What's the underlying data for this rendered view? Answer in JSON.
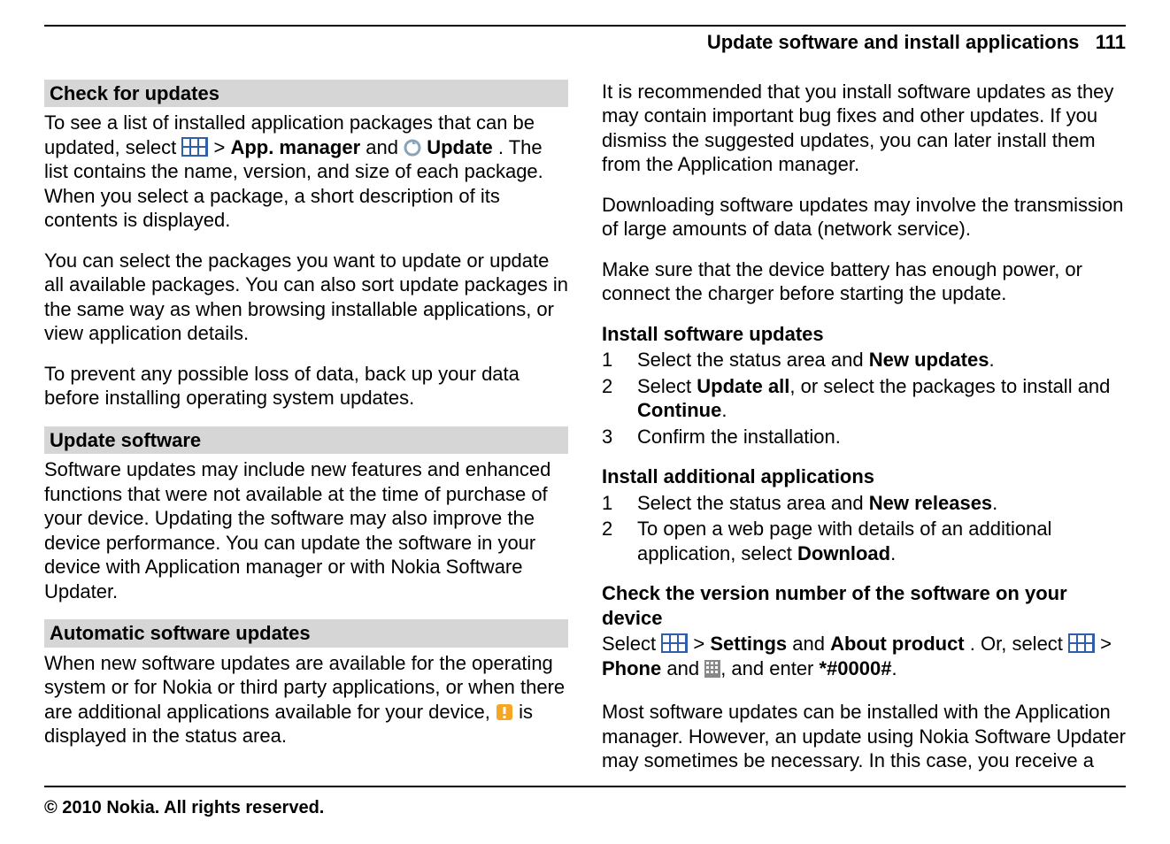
{
  "header": {
    "title": "Update software and install applications",
    "page_number": "111"
  },
  "left": {
    "sec1": {
      "title": "Check for updates",
      "p1a": "To see a list of installed application packages that can be updated, select ",
      "p1b": " > ",
      "app_manager": "App. manager",
      "and": " and ",
      "update": "Update",
      "p1c": ". The list contains the name, version, and size of each package. When you select a package, a short description of its contents is displayed.",
      "p2": "You can select the packages you want to update or update all available packages. You can also sort update packages in the same way as when browsing installable applications, or view application details.",
      "p3": "To prevent any possible loss of data, back up your data before installing operating system updates."
    },
    "sec2": {
      "title": "Update software",
      "p1": "Software updates may include new features and enhanced functions that were not available at the time of purchase of your device. Updating the software may also improve the device performance. You can update the software in your device with Application manager or with Nokia Software Updater."
    },
    "sec3": {
      "title": "Automatic software updates",
      "p1a": "When new software updates are available for the operating system or for Nokia or third party applications, or when there are additional applications available for your device, ",
      "p1b": " is displayed in the status area."
    }
  },
  "right": {
    "p1": "It is recommended that you install software updates as they may contain important bug fixes and other updates. If you dismiss the suggested updates, you can later install them from the Application manager.",
    "p2": "Downloading software updates may involve the transmission of large amounts of data (network service).",
    "p3": "Make sure that the device battery has enough power, or connect the charger before starting the update.",
    "sec1": {
      "title": "Install software updates",
      "steps": [
        {
          "n": "1",
          "pre": "Select the status area and ",
          "b1": "New updates",
          "post": "."
        },
        {
          "n": "2",
          "pre": "Select ",
          "b1": "Update all",
          "mid": ", or select the packages to install and ",
          "b2": "Continue",
          "post": "."
        },
        {
          "n": "3",
          "pre": "Confirm the installation."
        }
      ]
    },
    "sec2": {
      "title": "Install additional applications",
      "steps": [
        {
          "n": "1",
          "pre": "Select the status area and ",
          "b1": "New releases",
          "post": "."
        },
        {
          "n": "2",
          "pre": "To open a web page with details of an additional application, select ",
          "b1": "Download",
          "post": "."
        }
      ]
    },
    "sec3": {
      "title": "Check the version number of the software on your device",
      "select": "Select ",
      "gt": " > ",
      "settings": "Settings",
      "and": " and ",
      "about": "About product",
      "or": ". Or, select ",
      "phone": "Phone",
      "and2": " and ",
      "enter": ", and enter ",
      "code": "*#0000#",
      "dot": "."
    },
    "p4": "Most software updates can be installed with the Application manager. However, an update using Nokia Software Updater may sometimes be necessary. In this case, you receive a"
  },
  "footer": "© 2010 Nokia. All rights reserved."
}
